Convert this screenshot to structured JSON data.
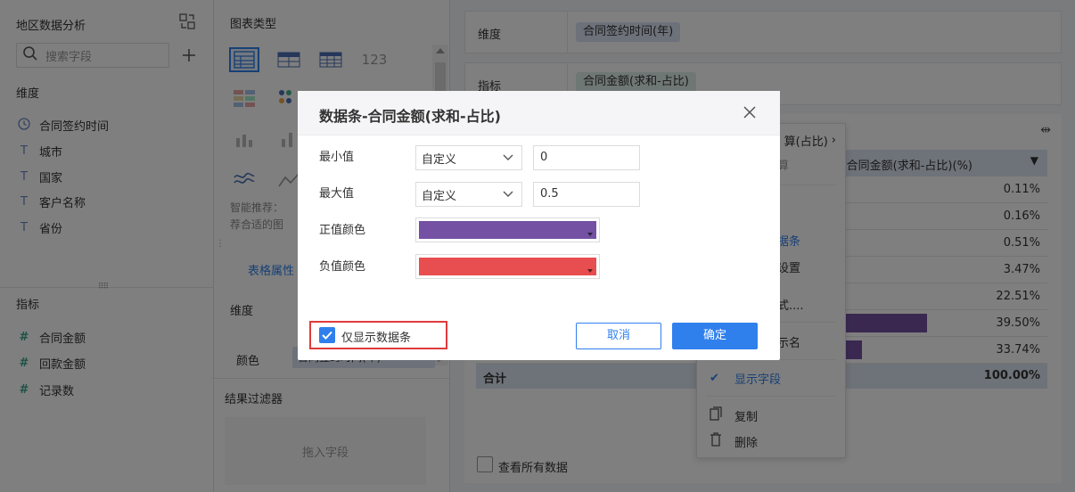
{
  "left": {
    "title": "地区数据分析",
    "search_placeholder": "搜索字段",
    "dimension_title": "维度",
    "dimensions": [
      {
        "label": "合同签约时间",
        "icon": "clock-icon"
      },
      {
        "label": "城市",
        "icon": "text-field-icon"
      },
      {
        "label": "国家",
        "icon": "text-field-icon"
      },
      {
        "label": "客户名称",
        "icon": "text-field-icon"
      },
      {
        "label": "省份",
        "icon": "text-field-icon"
      }
    ],
    "measure_title": "指标",
    "measures": [
      {
        "label": "合同金额",
        "icon": "number-field-icon"
      },
      {
        "label": "回款金额",
        "icon": "number-field-icon"
      },
      {
        "label": "记录数",
        "icon": "number-field-icon"
      }
    ]
  },
  "middle": {
    "chart_type_title": "图表类型",
    "recommend_text_1": "智能推荐：",
    "recommend_text_2": "荐合适的图",
    "table_props_tab": "表格属性",
    "dimension_label": "维度",
    "color_label": "颜色",
    "color_value": "合同签约时间(年)",
    "result_filter_title": "结果过滤器",
    "drag_placeholder": "拖入字段"
  },
  "right": {
    "dimension_label": "维度",
    "dimension_pill": "合同签约时间(年)",
    "measure_label": "指标",
    "measure_pill": "合同金额(求和-占比)",
    "column_header": "合同金额(求和-占比)(%)",
    "values": [
      "0.11%",
      "0.16%",
      "0.51%",
      "3.47%",
      "22.51%",
      "39.50%",
      "33.74%"
    ],
    "bar_fractions": [
      0.0022,
      0.0032,
      0.0102,
      0.0694,
      0.4502,
      0.79,
      0.6748
    ],
    "total_label": "合计",
    "total_value": "100.00%",
    "view_all_label": "查看所有数据"
  },
  "context_menu": {
    "item_top_1": "算(占比)",
    "item_top_2": "算",
    "item_databar": "据条",
    "item_settings": "设置",
    "item_style": "式....",
    "item_rename": "示名",
    "item_show_field": "显示字段",
    "item_copy": "复制",
    "item_delete": "删除"
  },
  "dialog": {
    "title": "数据条-合同金额(求和-占比)",
    "min_label": "最小值",
    "min_mode": "自定义",
    "min_value": "0",
    "max_label": "最大值",
    "max_mode": "自定义",
    "max_value": "0.5",
    "pos_color_label": "正值颜色",
    "pos_color": "#7451a3",
    "neg_color_label": "负值颜色",
    "neg_color": "#e84e4f",
    "only_bar_label": "仅显示数据条",
    "only_bar_checked": true,
    "cancel_label": "取消",
    "ok_label": "确定"
  },
  "colors": {
    "accent": "#2f80ed",
    "measure_pill_bg": "#dfeeeb",
    "dimension_pill_bg": "#dbe2f3",
    "header_bg": "#dde4f2"
  }
}
